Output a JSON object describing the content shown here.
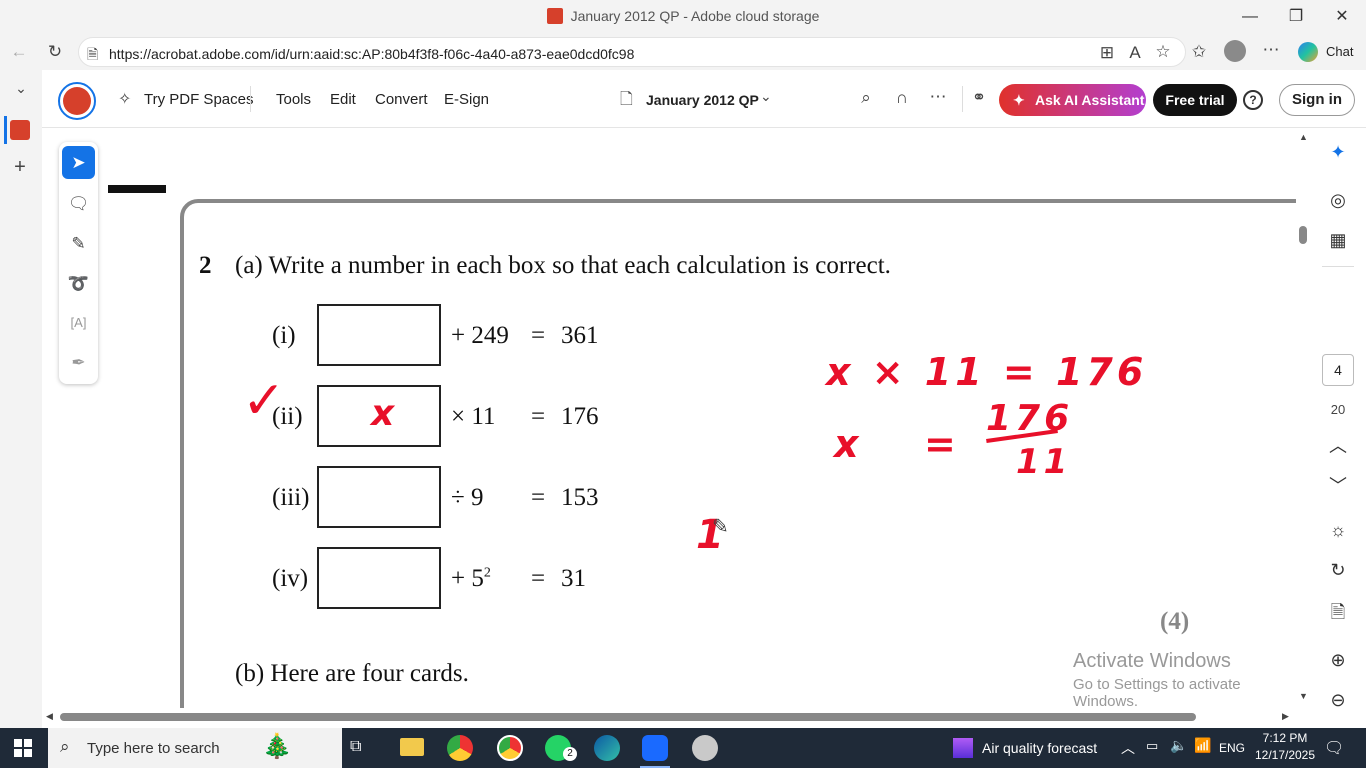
{
  "window": {
    "title": "January 2012 QP - Adobe cloud storage",
    "controls": {
      "minimize": "—",
      "restore": "❐",
      "close": "✕"
    }
  },
  "browser": {
    "url": "https://acrobat.adobe.com/id/urn:aaid:sc:AP:80b4f3f8-f06c-4a40-a873-eae0dcd0fc98",
    "chat_label": "Chat"
  },
  "app": {
    "try_spaces": "Try PDF Spaces",
    "nav": [
      "Tools",
      "Edit",
      "Convert",
      "E-Sign"
    ],
    "doc_title": "January 2012 QP",
    "ai_button": "Ask AI Assistant",
    "free_trial": "Free trial",
    "sign_in": "Sign in"
  },
  "page_nav": {
    "current_page": "4",
    "total_pages": "20"
  },
  "document": {
    "q_number": "2",
    "q_a": "(a) Write a number in each box so that each calculation is correct.",
    "rows": [
      {
        "label": "(i)",
        "op": "+ 249",
        "eq": "=",
        "result": "361",
        "answer": ""
      },
      {
        "label": "(ii)",
        "op": "× 11",
        "eq": "=",
        "result": "176",
        "answer": "x"
      },
      {
        "label": "(iii)",
        "op": "÷ 9",
        "eq": "=",
        "result": "153",
        "answer": ""
      },
      {
        "label": "(iv)",
        "op": "+ 5",
        "op_sup": "2",
        "eq": "=",
        "result": "31",
        "answer": ""
      }
    ],
    "marks": "(4)",
    "q_b": "(b) Here are four cards."
  },
  "handwriting": {
    "line1": "x × 11 = 176",
    "line2_lhs": "x",
    "line2_eq": "=",
    "numerator": "176",
    "denominator": "11",
    "stray": "1",
    "tick": "✓"
  },
  "watermark": {
    "title": "Activate Windows",
    "subtitle": "Go to Settings to activate Windows."
  },
  "taskbar": {
    "search_placeholder": "Type here to search",
    "weather": "Air quality forecast",
    "lang": "ENG",
    "time": "7:12 PM",
    "date": "12/17/2025",
    "whatsapp_badge": "2"
  },
  "colors": {
    "annotation": "#e8102a",
    "accent": "#1473e6",
    "adobe_red": "#d6402b"
  }
}
